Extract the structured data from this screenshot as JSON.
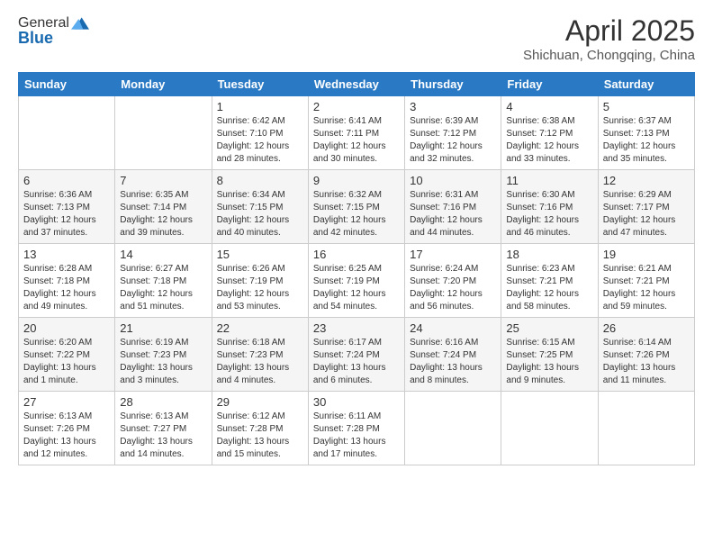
{
  "app": {
    "logo_line1": "General",
    "logo_line2": "Blue"
  },
  "header": {
    "month": "April 2025",
    "location": "Shichuan, Chongqing, China"
  },
  "weekdays": [
    "Sunday",
    "Monday",
    "Tuesday",
    "Wednesday",
    "Thursday",
    "Friday",
    "Saturday"
  ],
  "weeks": [
    [
      {
        "day": "",
        "info": ""
      },
      {
        "day": "",
        "info": ""
      },
      {
        "day": "1",
        "info": "Sunrise: 6:42 AM\nSunset: 7:10 PM\nDaylight: 12 hours and 28 minutes."
      },
      {
        "day": "2",
        "info": "Sunrise: 6:41 AM\nSunset: 7:11 PM\nDaylight: 12 hours and 30 minutes."
      },
      {
        "day": "3",
        "info": "Sunrise: 6:39 AM\nSunset: 7:12 PM\nDaylight: 12 hours and 32 minutes."
      },
      {
        "day": "4",
        "info": "Sunrise: 6:38 AM\nSunset: 7:12 PM\nDaylight: 12 hours and 33 minutes."
      },
      {
        "day": "5",
        "info": "Sunrise: 6:37 AM\nSunset: 7:13 PM\nDaylight: 12 hours and 35 minutes."
      }
    ],
    [
      {
        "day": "6",
        "info": "Sunrise: 6:36 AM\nSunset: 7:13 PM\nDaylight: 12 hours and 37 minutes."
      },
      {
        "day": "7",
        "info": "Sunrise: 6:35 AM\nSunset: 7:14 PM\nDaylight: 12 hours and 39 minutes."
      },
      {
        "day": "8",
        "info": "Sunrise: 6:34 AM\nSunset: 7:15 PM\nDaylight: 12 hours and 40 minutes."
      },
      {
        "day": "9",
        "info": "Sunrise: 6:32 AM\nSunset: 7:15 PM\nDaylight: 12 hours and 42 minutes."
      },
      {
        "day": "10",
        "info": "Sunrise: 6:31 AM\nSunset: 7:16 PM\nDaylight: 12 hours and 44 minutes."
      },
      {
        "day": "11",
        "info": "Sunrise: 6:30 AM\nSunset: 7:16 PM\nDaylight: 12 hours and 46 minutes."
      },
      {
        "day": "12",
        "info": "Sunrise: 6:29 AM\nSunset: 7:17 PM\nDaylight: 12 hours and 47 minutes."
      }
    ],
    [
      {
        "day": "13",
        "info": "Sunrise: 6:28 AM\nSunset: 7:18 PM\nDaylight: 12 hours and 49 minutes."
      },
      {
        "day": "14",
        "info": "Sunrise: 6:27 AM\nSunset: 7:18 PM\nDaylight: 12 hours and 51 minutes."
      },
      {
        "day": "15",
        "info": "Sunrise: 6:26 AM\nSunset: 7:19 PM\nDaylight: 12 hours and 53 minutes."
      },
      {
        "day": "16",
        "info": "Sunrise: 6:25 AM\nSunset: 7:19 PM\nDaylight: 12 hours and 54 minutes."
      },
      {
        "day": "17",
        "info": "Sunrise: 6:24 AM\nSunset: 7:20 PM\nDaylight: 12 hours and 56 minutes."
      },
      {
        "day": "18",
        "info": "Sunrise: 6:23 AM\nSunset: 7:21 PM\nDaylight: 12 hours and 58 minutes."
      },
      {
        "day": "19",
        "info": "Sunrise: 6:21 AM\nSunset: 7:21 PM\nDaylight: 12 hours and 59 minutes."
      }
    ],
    [
      {
        "day": "20",
        "info": "Sunrise: 6:20 AM\nSunset: 7:22 PM\nDaylight: 13 hours and 1 minute."
      },
      {
        "day": "21",
        "info": "Sunrise: 6:19 AM\nSunset: 7:23 PM\nDaylight: 13 hours and 3 minutes."
      },
      {
        "day": "22",
        "info": "Sunrise: 6:18 AM\nSunset: 7:23 PM\nDaylight: 13 hours and 4 minutes."
      },
      {
        "day": "23",
        "info": "Sunrise: 6:17 AM\nSunset: 7:24 PM\nDaylight: 13 hours and 6 minutes."
      },
      {
        "day": "24",
        "info": "Sunrise: 6:16 AM\nSunset: 7:24 PM\nDaylight: 13 hours and 8 minutes."
      },
      {
        "day": "25",
        "info": "Sunrise: 6:15 AM\nSunset: 7:25 PM\nDaylight: 13 hours and 9 minutes."
      },
      {
        "day": "26",
        "info": "Sunrise: 6:14 AM\nSunset: 7:26 PM\nDaylight: 13 hours and 11 minutes."
      }
    ],
    [
      {
        "day": "27",
        "info": "Sunrise: 6:13 AM\nSunset: 7:26 PM\nDaylight: 13 hours and 12 minutes."
      },
      {
        "day": "28",
        "info": "Sunrise: 6:13 AM\nSunset: 7:27 PM\nDaylight: 13 hours and 14 minutes."
      },
      {
        "day": "29",
        "info": "Sunrise: 6:12 AM\nSunset: 7:28 PM\nDaylight: 13 hours and 15 minutes."
      },
      {
        "day": "30",
        "info": "Sunrise: 6:11 AM\nSunset: 7:28 PM\nDaylight: 13 hours and 17 minutes."
      },
      {
        "day": "",
        "info": ""
      },
      {
        "day": "",
        "info": ""
      },
      {
        "day": "",
        "info": ""
      }
    ]
  ]
}
